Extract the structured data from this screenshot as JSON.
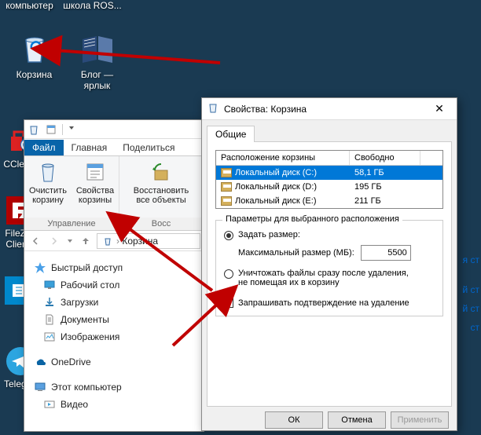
{
  "desktop": {
    "icons": [
      {
        "name": "my-computer",
        "label": "компьютер"
      },
      {
        "name": "ros-school",
        "label": "школа ROS..."
      },
      {
        "name": "recycle-bin",
        "label": "Корзина"
      },
      {
        "name": "blog-shortcut",
        "label": "Блог —\nярлык"
      },
      {
        "name": "ccleaner",
        "label": "CClea..."
      },
      {
        "name": "filezilla",
        "label": "FileZi...\nClien..."
      },
      {
        "name": "telegram",
        "label": "Telegr..."
      }
    ]
  },
  "explorer": {
    "tabs": {
      "file": "Файл",
      "home": "Главная",
      "share": "Поделиться"
    },
    "ribbon": {
      "group1": {
        "empty": "Очистить\nкорзину",
        "props": "Свойства\nкорзины",
        "title": "Управление"
      },
      "group2": {
        "restore_all": "Восстановить\nвсе объекты",
        "title": "Восс"
      }
    },
    "breadcrumb": "Корзина",
    "nav": {
      "quick": "Быстрый доступ",
      "desktop": "Рабочий стол",
      "downloads": "Загрузки",
      "documents": "Документы",
      "pictures": "Изображения",
      "onedrive": "OneDrive",
      "this_pc": "Этот компьютер",
      "videos": "Видео"
    }
  },
  "props": {
    "title": "Свойства: Корзина",
    "tab_general": "Общие",
    "table": {
      "col_location": "Расположение корзины",
      "col_free": "Свободно",
      "rows": [
        {
          "location": "Локальный диск (C:)",
          "free": "58,1 ГБ"
        },
        {
          "location": "Локальный диск (D:)",
          "free": "195 ГБ"
        },
        {
          "location": "Локальный диск (E:)",
          "free": "211 ГБ"
        }
      ]
    },
    "params_title": "Параметры для выбранного расположения",
    "radio_size": "Задать размер:",
    "max_size_label": "Максимальный размер (МБ):",
    "max_size_value": "5500",
    "radio_delete": "Уничтожать файлы сразу после удаления, не помещая их в корзину",
    "confirm_label": "Запрашивать подтверждение на удаление",
    "ok": "ОК",
    "cancel": "Отмена",
    "apply": "Применить"
  },
  "edge": {
    "t1": "я ст",
    "t2": "й ст",
    "t3": "й ст",
    "t4": "ст"
  }
}
